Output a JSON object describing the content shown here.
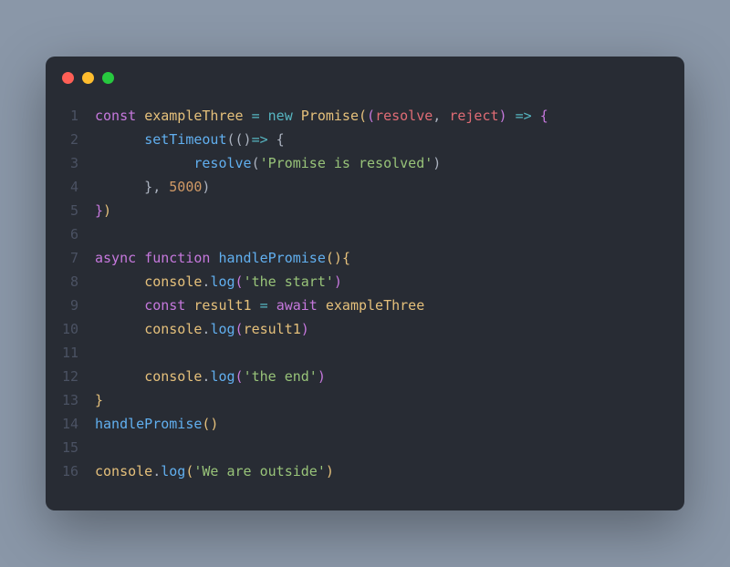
{
  "editor": {
    "traffic_lights": [
      "close",
      "minimize",
      "zoom"
    ],
    "lines": [
      {
        "num": "1",
        "tokens": [
          {
            "t": "const ",
            "c": "kw"
          },
          {
            "t": "exampleThree",
            "c": "var"
          },
          {
            "t": " ",
            "c": "pn"
          },
          {
            "t": "=",
            "c": "op"
          },
          {
            "t": " ",
            "c": "pn"
          },
          {
            "t": "new",
            "c": "op"
          },
          {
            "t": " ",
            "c": "pn"
          },
          {
            "t": "Promise",
            "c": "var"
          },
          {
            "t": "(",
            "c": "gold"
          },
          {
            "t": "(",
            "c": "pinkbr"
          },
          {
            "t": "resolve",
            "c": "prop"
          },
          {
            "t": ", ",
            "c": "pn"
          },
          {
            "t": "reject",
            "c": "prop"
          },
          {
            "t": ")",
            "c": "pinkbr"
          },
          {
            "t": " ",
            "c": "pn"
          },
          {
            "t": "=>",
            "c": "op"
          },
          {
            "t": " ",
            "c": "pn"
          },
          {
            "t": "{",
            "c": "pinkbr"
          }
        ]
      },
      {
        "num": "2",
        "tokens": [
          {
            "t": "      ",
            "c": "pn"
          },
          {
            "t": "setTimeout",
            "c": "fn"
          },
          {
            "t": "(()",
            "c": "pn"
          },
          {
            "t": "=>",
            "c": "op"
          },
          {
            "t": " {",
            "c": "pn"
          }
        ]
      },
      {
        "num": "3",
        "tokens": [
          {
            "t": "            ",
            "c": "pn"
          },
          {
            "t": "resolve",
            "c": "fn"
          },
          {
            "t": "(",
            "c": "pn"
          },
          {
            "t": "'Promise is resolved'",
            "c": "str"
          },
          {
            "t": ")",
            "c": "pn"
          }
        ]
      },
      {
        "num": "4",
        "tokens": [
          {
            "t": "      }, ",
            "c": "pn"
          },
          {
            "t": "5000",
            "c": "num"
          },
          {
            "t": ")",
            "c": "pn"
          }
        ]
      },
      {
        "num": "5",
        "tokens": [
          {
            "t": "}",
            "c": "pinkbr"
          },
          {
            "t": ")",
            "c": "gold"
          }
        ]
      },
      {
        "num": "6",
        "tokens": [
          {
            "t": "",
            "c": "pn"
          }
        ]
      },
      {
        "num": "7",
        "tokens": [
          {
            "t": "async",
            "c": "kw"
          },
          {
            "t": " ",
            "c": "pn"
          },
          {
            "t": "function",
            "c": "kw"
          },
          {
            "t": " ",
            "c": "pn"
          },
          {
            "t": "handlePromise",
            "c": "fn"
          },
          {
            "t": "()",
            "c": "gold"
          },
          {
            "t": "{",
            "c": "gold"
          }
        ]
      },
      {
        "num": "8",
        "tokens": [
          {
            "t": "      ",
            "c": "pn"
          },
          {
            "t": "console",
            "c": "var"
          },
          {
            "t": ".",
            "c": "pn"
          },
          {
            "t": "log",
            "c": "fn"
          },
          {
            "t": "(",
            "c": "pinkbr"
          },
          {
            "t": "'the start'",
            "c": "str"
          },
          {
            "t": ")",
            "c": "pinkbr"
          }
        ]
      },
      {
        "num": "9",
        "tokens": [
          {
            "t": "      ",
            "c": "pn"
          },
          {
            "t": "const",
            "c": "kw"
          },
          {
            "t": " ",
            "c": "pn"
          },
          {
            "t": "result1",
            "c": "var"
          },
          {
            "t": " ",
            "c": "pn"
          },
          {
            "t": "=",
            "c": "op"
          },
          {
            "t": " ",
            "c": "pn"
          },
          {
            "t": "await",
            "c": "kw"
          },
          {
            "t": " ",
            "c": "pn"
          },
          {
            "t": "exampleThree",
            "c": "var"
          }
        ]
      },
      {
        "num": "10",
        "tokens": [
          {
            "t": "      ",
            "c": "pn"
          },
          {
            "t": "console",
            "c": "var"
          },
          {
            "t": ".",
            "c": "pn"
          },
          {
            "t": "log",
            "c": "fn"
          },
          {
            "t": "(",
            "c": "pinkbr"
          },
          {
            "t": "result1",
            "c": "var"
          },
          {
            "t": ")",
            "c": "pinkbr"
          }
        ]
      },
      {
        "num": "11",
        "tokens": [
          {
            "t": "",
            "c": "pn"
          }
        ]
      },
      {
        "num": "12",
        "tokens": [
          {
            "t": "      ",
            "c": "pn"
          },
          {
            "t": "console",
            "c": "var"
          },
          {
            "t": ".",
            "c": "pn"
          },
          {
            "t": "log",
            "c": "fn"
          },
          {
            "t": "(",
            "c": "pinkbr"
          },
          {
            "t": "'the end'",
            "c": "str"
          },
          {
            "t": ")",
            "c": "pinkbr"
          }
        ]
      },
      {
        "num": "13",
        "tokens": [
          {
            "t": "}",
            "c": "gold"
          }
        ]
      },
      {
        "num": "14",
        "tokens": [
          {
            "t": "handlePromise",
            "c": "fn"
          },
          {
            "t": "()",
            "c": "gold"
          }
        ]
      },
      {
        "num": "15",
        "tokens": [
          {
            "t": "",
            "c": "pn"
          }
        ]
      },
      {
        "num": "16",
        "tokens": [
          {
            "t": "console",
            "c": "var"
          },
          {
            "t": ".",
            "c": "pn"
          },
          {
            "t": "log",
            "c": "fn"
          },
          {
            "t": "(",
            "c": "gold"
          },
          {
            "t": "'We are outside'",
            "c": "str"
          },
          {
            "t": ")",
            "c": "gold"
          }
        ]
      }
    ]
  }
}
